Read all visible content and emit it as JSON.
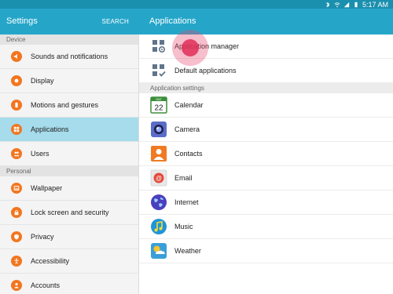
{
  "status_bar": {
    "time": "5:17 AM",
    "icons": [
      "bluetooth-icon",
      "wifi-icon",
      "signal-icon",
      "battery-icon"
    ]
  },
  "left_header": {
    "title": "Settings",
    "search_label": "SEARCH"
  },
  "right_header": {
    "title": "Applications"
  },
  "left_sections": [
    {
      "label": "Device",
      "items": [
        {
          "label": "Sounds and notifications",
          "icon": "volume-icon"
        },
        {
          "label": "Display",
          "icon": "display-icon"
        },
        {
          "label": "Motions and gestures",
          "icon": "motion-icon"
        },
        {
          "label": "Applications",
          "icon": "apps-icon",
          "selected": true
        },
        {
          "label": "Users",
          "icon": "users-icon"
        }
      ]
    },
    {
      "label": "Personal",
      "items": [
        {
          "label": "Wallpaper",
          "icon": "wallpaper-icon"
        },
        {
          "label": "Lock screen and security",
          "icon": "lock-icon"
        },
        {
          "label": "Privacy",
          "icon": "privacy-icon"
        },
        {
          "label": "Accessibility",
          "icon": "accessibility-icon"
        },
        {
          "label": "Accounts",
          "icon": "accounts-icon"
        }
      ]
    }
  ],
  "right_top_items": [
    {
      "label": "Application manager",
      "icon": "app-manager-icon"
    },
    {
      "label": "Default applications",
      "icon": "default-apps-icon"
    }
  ],
  "right_section_label": "Application settings",
  "calendar_icon": {
    "day": "SAT",
    "date": "22"
  },
  "app_items": [
    {
      "label": "Calendar",
      "icon": "calendar-icon"
    },
    {
      "label": "Camera",
      "icon": "camera-icon"
    },
    {
      "label": "Contacts",
      "icon": "contacts-icon"
    },
    {
      "label": "Email",
      "icon": "email-icon"
    },
    {
      "label": "Internet",
      "icon": "internet-icon"
    },
    {
      "label": "Music",
      "icon": "music-icon"
    },
    {
      "label": "Weather",
      "icon": "weather-icon"
    }
  ],
  "colors": {
    "header": "#25a6c9",
    "status_bar": "#1b8fae",
    "accent_orange": "#f2761f",
    "selected_row": "#a6dceb",
    "touch_indicator": "#e02e58"
  }
}
